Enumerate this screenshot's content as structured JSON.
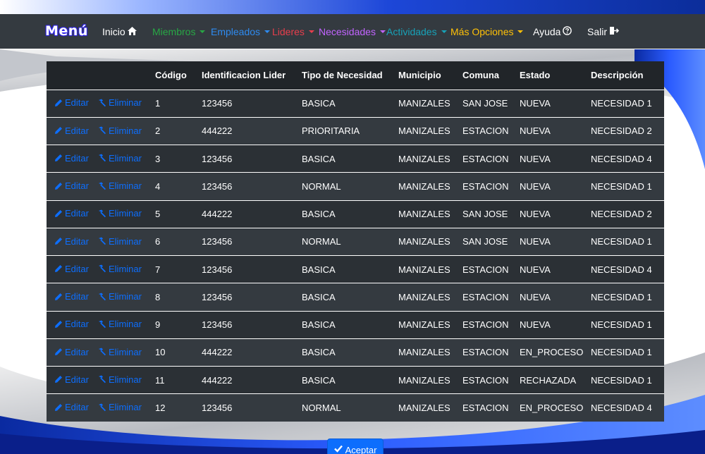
{
  "navbar": {
    "brand": "Menú",
    "items": [
      {
        "label": "Inicio",
        "color": "#ffffff",
        "icon": "home-icon"
      },
      {
        "label": "Miembros",
        "color": "#28a745",
        "icon": "caret-down-icon"
      },
      {
        "label": "Empleados",
        "color": "#2e8bf0",
        "icon": "caret-down-icon"
      },
      {
        "label": "Lideres",
        "color": "#e83e4c",
        "icon": "caret-down-icon"
      },
      {
        "label": "Necesidades",
        "color": "#c264ff",
        "icon": "caret-down-icon"
      },
      {
        "label": "Actividades",
        "color": "#17a2b8",
        "icon": "caret-down-icon"
      },
      {
        "label": "Más Opciones",
        "color": "#ffc107",
        "icon": "caret-down-icon"
      },
      {
        "label": "Ayuda",
        "color": "#ffffff",
        "icon": "help-icon"
      },
      {
        "label": "Salir",
        "color": "#ffffff",
        "icon": "exit-icon"
      }
    ]
  },
  "table": {
    "columns": [
      "",
      "",
      "Código",
      "Identificacion Lider",
      "Tipo de Necesidad",
      "Municipio",
      "Comuna",
      "Estado",
      "Descripción"
    ],
    "edit_label": "Editar",
    "delete_label": "Eliminar",
    "rows": [
      [
        "1",
        "123456",
        "BASICA",
        "MANIZALES",
        "SAN JOSE",
        "NUEVA",
        "NECESIDAD 1"
      ],
      [
        "2",
        "444222",
        "PRIORITARIA",
        "MANIZALES",
        "ESTACION",
        "NUEVA",
        "NECESIDAD 2"
      ],
      [
        "3",
        "123456",
        "BASICA",
        "MANIZALES",
        "ESTACION",
        "NUEVA",
        "NECESIDAD 4"
      ],
      [
        "4",
        "123456",
        "NORMAL",
        "MANIZALES",
        "ESTACION",
        "NUEVA",
        "NECESIDAD 1"
      ],
      [
        "5",
        "444222",
        "BASICA",
        "MANIZALES",
        "SAN JOSE",
        "NUEVA",
        "NECESIDAD 2"
      ],
      [
        "6",
        "123456",
        "NORMAL",
        "MANIZALES",
        "SAN JOSE",
        "NUEVA",
        "NECESIDAD 1"
      ],
      [
        "7",
        "123456",
        "BASICA",
        "MANIZALES",
        "ESTACION",
        "NUEVA",
        "NECESIDAD 4"
      ],
      [
        "8",
        "123456",
        "BASICA",
        "MANIZALES",
        "ESTACION",
        "NUEVA",
        "NECESIDAD 1"
      ],
      [
        "9",
        "123456",
        "BASICA",
        "MANIZALES",
        "ESTACION",
        "NUEVA",
        "NECESIDAD 1"
      ],
      [
        "10",
        "444222",
        "BASICA",
        "MANIZALES",
        "ESTACION",
        "EN_PROCESO",
        "NECESIDAD 1"
      ],
      [
        "11",
        "444222",
        "BASICA",
        "MANIZALES",
        "ESTACION",
        "RECHAZADA",
        "NECESIDAD 1"
      ],
      [
        "12",
        "123456",
        "NORMAL",
        "MANIZALES",
        "ESTACION",
        "EN_PROCESO",
        "NECESIDAD 4"
      ]
    ]
  },
  "accept_button": {
    "label": "Aceptar",
    "icon": "check-icon"
  },
  "colors": {
    "navbar_bg": "#343a40",
    "link_blue": "#0d6efd",
    "table_bg": "#343a40"
  }
}
